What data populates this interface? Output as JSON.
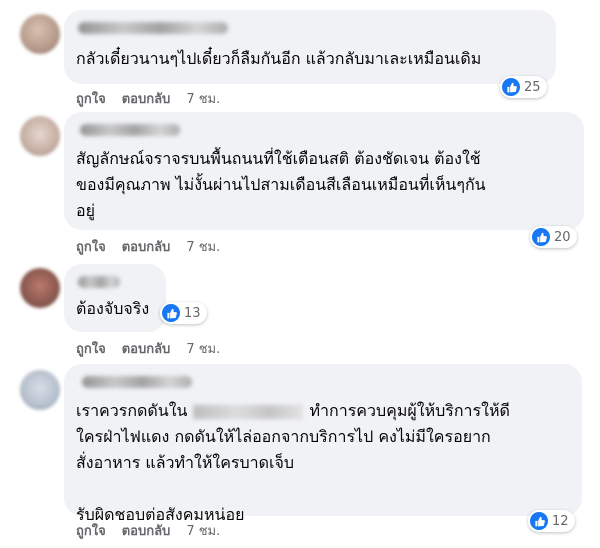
{
  "comments": [
    {
      "text": "กลัวเดี๋ยวนานๆไปเดี๋ยวก็ลืมกันอีก แล้วกลับมาเละเหมือนเดิม",
      "reactions": "25",
      "actions": {
        "like": "ถูกใจ",
        "reply": "ตอบกลับ",
        "time": "7 ชม."
      }
    },
    {
      "text": "สัญลักษณ์จราจรบนพื้นถนนที่ใช้เตือนสติ ต้องชัดเจน ต้องใช้\nของมีคุณภาพ ไม่งั้นผ่านไปสามเดือนสีเลือนเหมือนที่เห็นๆกัน\nอยู่",
      "reactions": "20",
      "actions": {
        "like": "ถูกใจ",
        "reply": "ตอบกลับ",
        "time": "7 ชม."
      }
    },
    {
      "text": "ต้องจับจริง",
      "reactions": "13",
      "actions": {
        "like": "ถูกใจ",
        "reply": "ตอบกลับ",
        "time": "7 ชม."
      }
    },
    {
      "text_before_blur": "เราควรกดดันใน",
      "text_after_blur": "ทำการควบคุมผู้ให้บริการให้ดี",
      "text_rest": "ใครฝ่าไฟแดง กดดันให้ไล่ออกจากบริการไป คงไม่มีใครอยาก\nสั่งอาหาร แล้วทำให้ใครบาดเจ็บ\n\nรับผิดชอบต่อสังคมหน่อย",
      "reactions": "12",
      "actions": {
        "like": "ถูกใจ",
        "reply": "ตอบกลับ",
        "time": "7 ชม."
      }
    }
  ],
  "icons": {
    "reaction": "like-icon"
  },
  "colors": {
    "bubble": "#f0f2f5",
    "like_blue": "#1877f2",
    "meta_gray": "#65676b"
  }
}
